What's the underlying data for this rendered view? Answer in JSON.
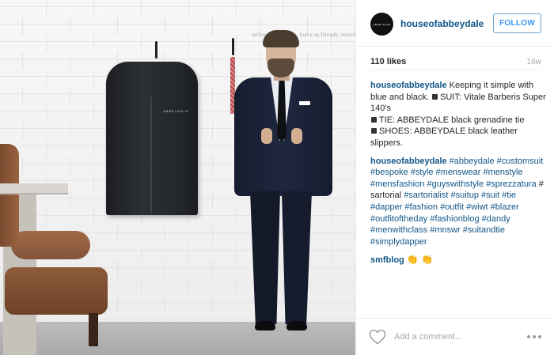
{
  "post": {
    "username": "houseofabbeydale",
    "follow_label": "FOLLOW",
    "likes": "110 likes",
    "time": "16w",
    "avatar_text": "ABBEYDALE",
    "photo_text": {
      "wall_quote": "arrive as strangers, leave as friends, return as family",
      "bag_logo": "ABBEYDALE"
    },
    "caption": {
      "user": "houseofabbeydale",
      "line1": "Keeping it simple with blue and black.",
      "line1_item": "SUIT: Vitale Barberis Super 140's",
      "line2_item": "TIE: ABBEYDALE black grenadine tie",
      "line3_item": "SHOES: ABBEYDALE black leather slippers."
    },
    "tags_comment": {
      "user": "houseofabbeydale",
      "tags_a": "#abbeydale #customsuit #bespoke #style #menswear #menstyle #mensfashion #guyswithstyle #sprezzatura",
      "plain_word": "# sartorial",
      "tags_b": "#sartorialist #suitup #suit #tie #dapper #fashion #outfit #wiwt #blazer #outfitoftheday #fashionblog #dandy #menwithclass #mnswr #suitandtie #simplydapper"
    },
    "second_comment": {
      "user": "smfblog",
      "emoji": "👏 👏"
    },
    "add_comment_placeholder": "Add a comment...",
    "icons": {
      "like": "heart-icon",
      "more": "more-options-icon"
    },
    "colors": {
      "link": "#125688",
      "follow": "#3897f0",
      "muted": "#a5a7aa"
    }
  }
}
